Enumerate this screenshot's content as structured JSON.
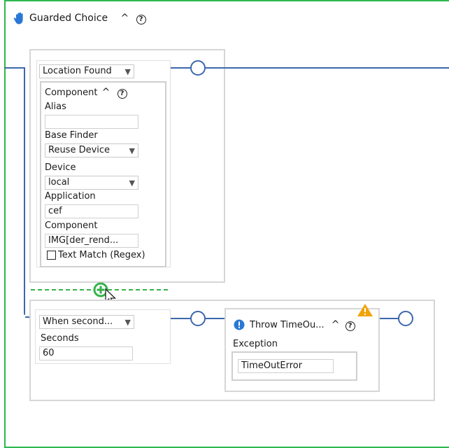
{
  "guarded_choice": {
    "title": "Guarded Choice",
    "caret": "^",
    "help": "?"
  },
  "branch1": {
    "condition_select": "Location Found",
    "component": {
      "title": "Component",
      "caret": "^",
      "help": "?",
      "alias_label": "Alias",
      "alias_value": "",
      "base_finder_label": "Base Finder",
      "base_finder_value": "Reuse Device",
      "device_label": "Device",
      "device_value": "local",
      "application_label": "Application",
      "application_value": "cef",
      "component_label": "Component",
      "component_value": "IMG[der_rend...",
      "text_match_label": "Text Match (Regex)",
      "text_match_checked": false
    }
  },
  "branch2": {
    "condition_select": "When second...",
    "seconds_label": "Seconds",
    "seconds_value": "60",
    "throw": {
      "title": "Throw TimeOu...",
      "caret": "^",
      "help": "?",
      "exception_label": "Exception",
      "exception_value": "TimeOutError"
    }
  },
  "colors": {
    "frame": "#2db84d",
    "connector": "#3d67ad",
    "add": "#35b24a",
    "warning": "#f0a30a",
    "info": "#2a78d6"
  },
  "icons": {
    "hand": "hand-icon",
    "add": "add-circle-icon",
    "warning": "warning-icon",
    "info": "info-icon",
    "dropdown": "chevron-down-icon",
    "cursor": "mouse-pointer-icon"
  }
}
